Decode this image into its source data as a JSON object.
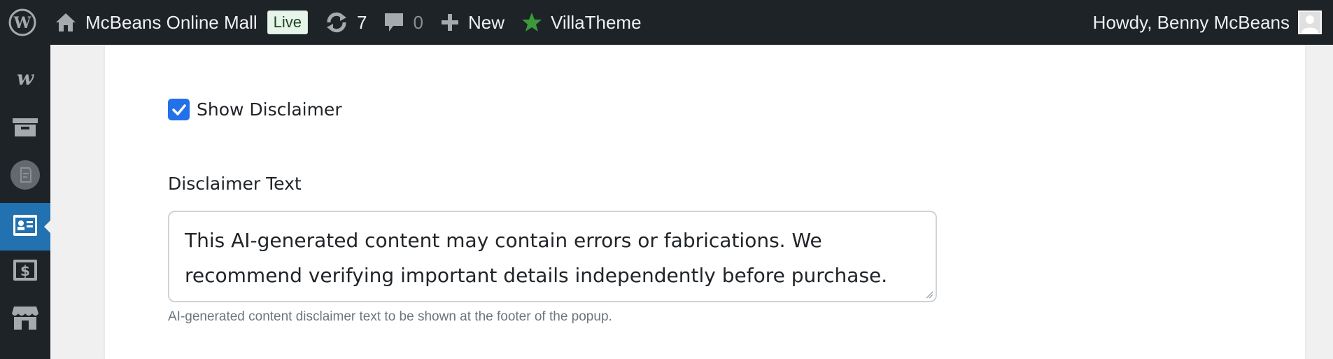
{
  "adminbar": {
    "site_name": "McBeans Online Mall",
    "live_badge": "Live",
    "updates_count": "7",
    "comments_count": "0",
    "new_label": "New",
    "villatheme_label": "VillaTheme",
    "howdy": "Howdy, Benny McBeans"
  },
  "icons": {
    "wordpress": "wordpress-logo-icon",
    "home": "home-icon",
    "updates": "refresh-icon",
    "comments": "comment-icon",
    "new": "plus-icon",
    "villatheme": "star-icon",
    "avatar": "user-avatar"
  },
  "sidebar": {
    "items": [
      {
        "icon": "woocommerce-icon"
      },
      {
        "icon": "archive-box-icon"
      },
      {
        "icon": "plugin-badge-icon"
      },
      {
        "icon": "id-card-icon",
        "active": true
      },
      {
        "icon": "dollar-icon"
      },
      {
        "icon": "store-icon"
      }
    ]
  },
  "form": {
    "show_disclaimer_label": "Show Disclaimer",
    "show_disclaimer_checked": true,
    "disclaimer_text_label": "Disclaimer Text",
    "disclaimer_text_value": "This AI-generated content may contain errors or fabrications. We recommend verifying important details independently before purchase.",
    "help_text": "AI-generated content disclaimer text to be shown at the footer of the popup."
  },
  "colors": {
    "adminbar_bg": "#1d2327",
    "active_menu": "#2271b1",
    "checkbox": "#2271e8",
    "star": "#3a9a3a",
    "live_badge_bg": "#e6f4ea"
  }
}
